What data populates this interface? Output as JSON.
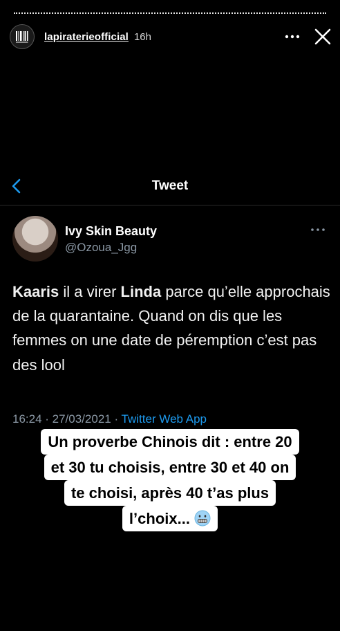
{
  "story": {
    "username": "lapiraterieofficial",
    "time": "16h"
  },
  "nav": {
    "title": "Tweet"
  },
  "tweet": {
    "author_name": "Ivy Skin Beauty",
    "author_handle": "@Ozoua_Jgg",
    "text_parts": [
      "Kaaris",
      " il a virer ",
      "Linda",
      " parce qu’elle approchais de la quarantaine. Quand on dis que les femmes on une date de péremption c’est pas des lool"
    ],
    "timestamp": "16:24 · 27/03/2021 · ",
    "source": "Twitter Web App"
  },
  "caption": {
    "lines": [
      "Un proverbe Chinois dit : entre 20",
      "et 30 tu choisis, entre 30 et 40 on",
      "te choisi, après 40 t’as plus",
      "l’choix... "
    ],
    "emoji": "grimacing-cold-face-emoji"
  },
  "colors": {
    "background": "#000000",
    "link": "#1d9bf0",
    "muted": "#8b98a5"
  }
}
